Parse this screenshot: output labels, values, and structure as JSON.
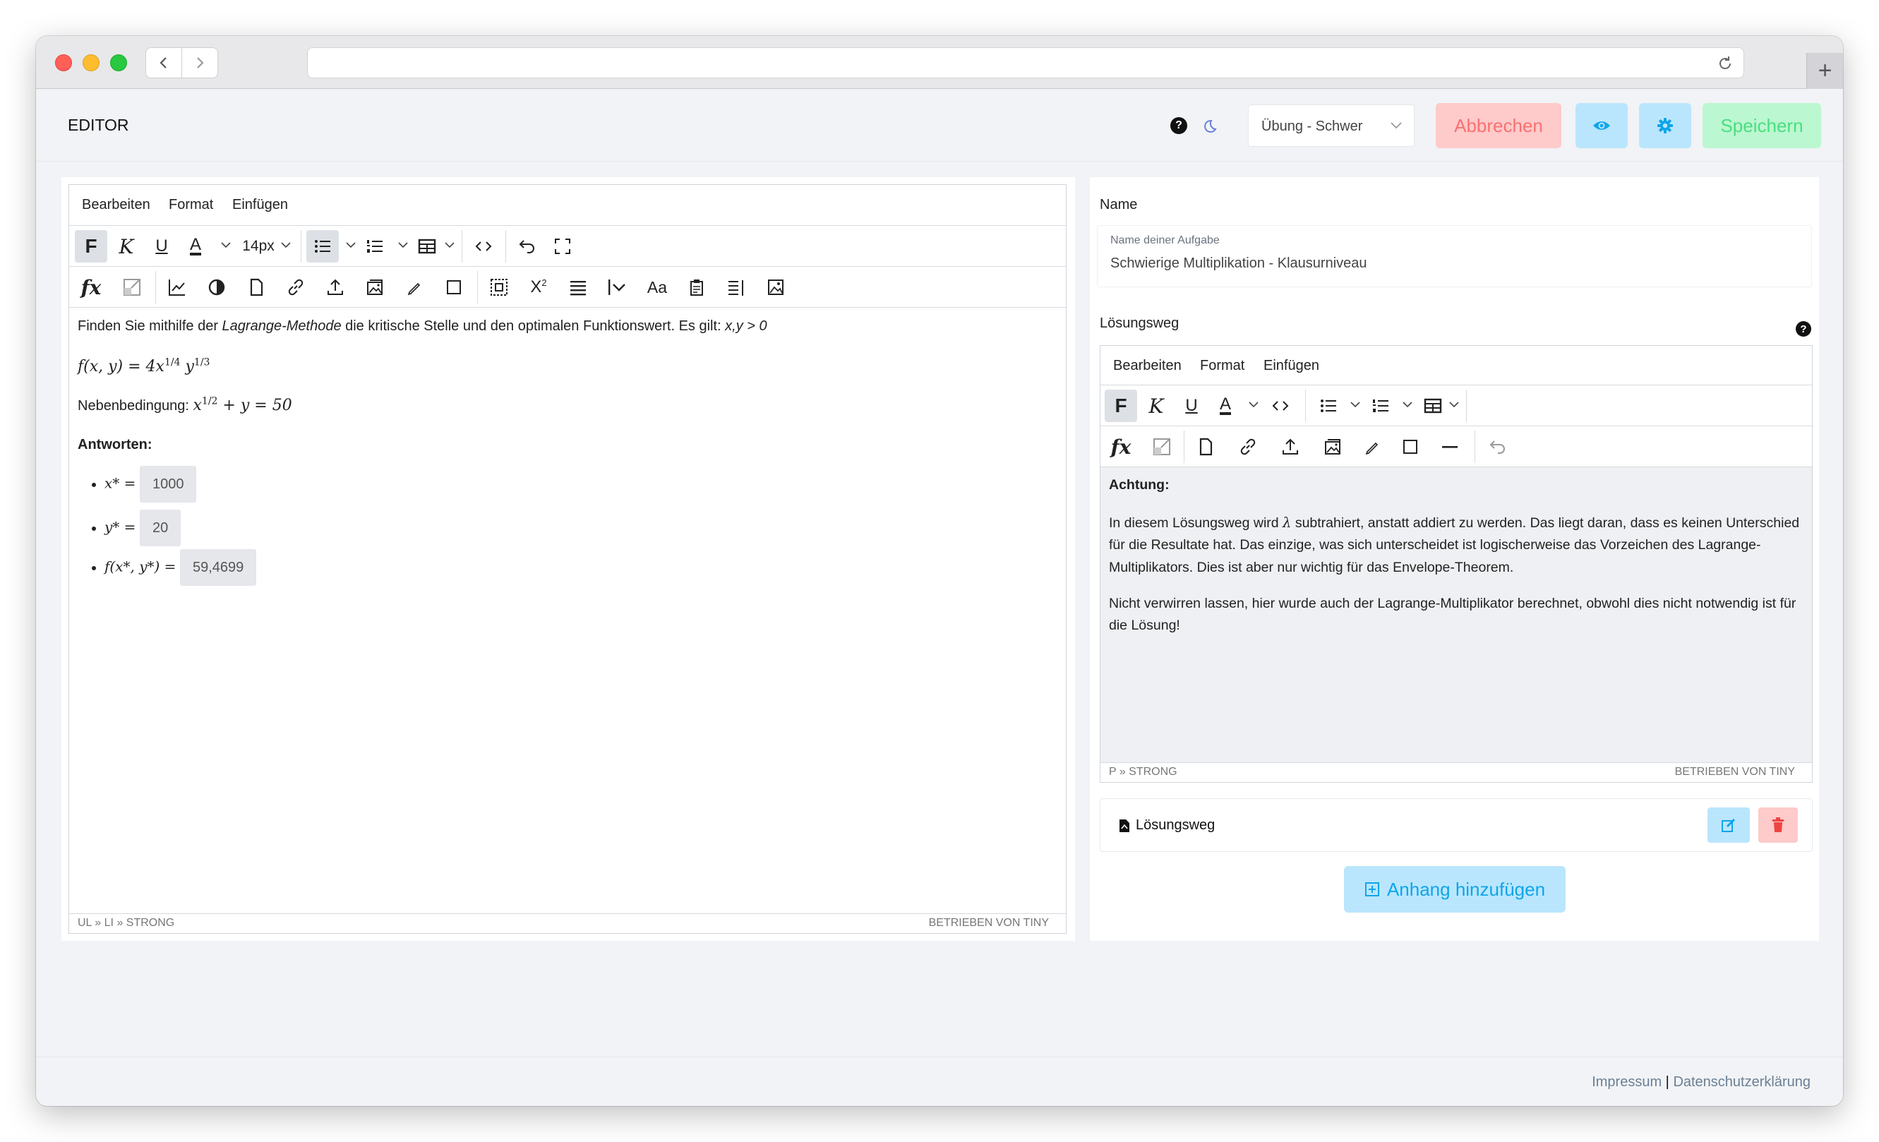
{
  "app": {
    "title": "EDITOR"
  },
  "header": {
    "difficulty_select": "Übung - Schwer",
    "cancel_label": "Abbrechen",
    "save_label": "Speichern",
    "icons": [
      "help-icon",
      "moon-icon",
      "eye-icon",
      "gear-icon"
    ],
    "colors": {
      "cancel_bg": "#fecaca",
      "cancel_text": "#f87171",
      "info_bg": "#bae6fd",
      "info_icon": "#0ea5e9",
      "save_bg": "#bbf7d0",
      "save_text": "#4ade80"
    }
  },
  "task_editor": {
    "menus": [
      "Bearbeiten",
      "Format",
      "Einfügen"
    ],
    "font_size": "14px",
    "content": {
      "intro_before": "Finden Sie mithilfe der ",
      "intro_em": "Lagrange-Methode",
      "intro_after": " die kritische Stelle und den optimalen Funktionswert. Es gilt: ",
      "intro_cond": "x,y > 0",
      "formula": "f(x,y) = 4x^(1/4) y^(1/3)",
      "constraint_label": "Nebenbedingung:",
      "constraint": "x^(1/2) + y = 50",
      "answers_label": "Antworten:",
      "answers": [
        {
          "label": "x* =",
          "value": "1000"
        },
        {
          "label": "y* =",
          "value": "20"
        },
        {
          "label": "f(x*, y*) =",
          "value": "59,4699"
        }
      ]
    },
    "status_path": "UL » LI » STRONG",
    "powered_by": "BETRIEBEN VON TINY"
  },
  "side": {
    "name_label": "Name",
    "name_field_label": "Name deiner Aufgabe",
    "name_value": "Schwierige Multiplikation - Klausurniveau",
    "solution_label": "Lösungsweg",
    "solution_editor": {
      "menus": [
        "Bearbeiten",
        "Format",
        "Einfügen"
      ],
      "heading": "Achtung:",
      "para1_before": "In diesem Lösungsweg wird ",
      "para1_symbol": "λ",
      "para1_after": " subtrahiert, anstatt addiert zu werden. Das liegt daran, dass es keinen Unterschied für die Resultate hat. Das einzige, was sich unterscheidet ist logischerweise das Vorzeichen des Lagrange-Multiplikators. Dies ist aber nur wichtig für das Envelope-Theorem.",
      "para2": "Nicht verwirren lassen, hier wurde auch der Lagrange-Multiplikator berechnet, obwohl dies nicht notwendig ist für die Lösung!",
      "status_path": "P » STRONG",
      "powered_by": "BETRIEBEN VON TINY"
    },
    "attachment_name": "Lösungsweg",
    "add_attachment_label": "Anhang hinzufügen"
  },
  "footer": {
    "impressum": "Impressum",
    "separator": "|",
    "privacy": "Datenschutzerklärung"
  }
}
